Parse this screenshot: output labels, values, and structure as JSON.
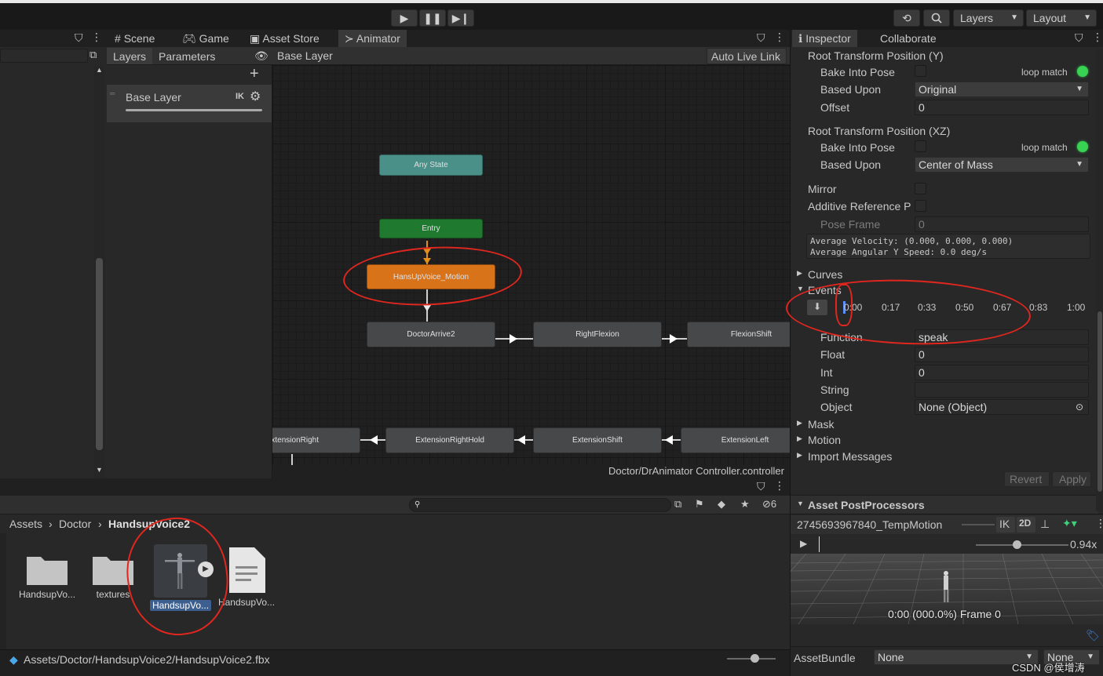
{
  "toolbar": {
    "layers_label": "Layers",
    "layout_label": "Layout"
  },
  "hierarchy": {},
  "center_tabs": [
    "Scene",
    "Game",
    "Asset Store",
    "Animator"
  ],
  "animator": {
    "left_tabs": [
      "Layers",
      "Parameters"
    ],
    "breadcrumb": "Base Layer",
    "auto_live_link": "Auto Live Link",
    "layer_name": "Base Layer",
    "ik_label": "IK",
    "footer_path": "Doctor/DrAnimator Controller.controller",
    "nodes": {
      "any_state": "Any State",
      "entry": "Entry",
      "motion": "HansUpVoice_Motion",
      "doctor_arrive": "DoctorArrive2",
      "right_flexion": "RightFlexion",
      "flexion_shift": "FlexionShift",
      "extension_right": "ExtensionRight",
      "extension_right_hold": "ExtensionRightHold",
      "extension_shift": "ExtensionShift",
      "extension_left": "ExtensionLeft"
    }
  },
  "inspector": {
    "tabs": [
      "Inspector",
      "Collaborate"
    ],
    "root_y_title": "Root Transform Position (Y)",
    "bake_into_pose": "Bake Into Pose",
    "loop_match": "loop match",
    "based_upon": "Based Upon",
    "based_upon_y": "Original",
    "offset_label": "Offset",
    "offset_value": "0",
    "root_xz_title": "Root Transform Position (XZ)",
    "based_upon_xz": "Center of Mass",
    "mirror": "Mirror",
    "additive_ref": "Additive Reference P",
    "pose_frame": "Pose Frame",
    "pose_frame_value": "0",
    "avg_velocity": "Average Velocity: (0.000, 0.000, 0.000)",
    "avg_angular": "Average Angular Y Speed: 0.0 deg/s",
    "curves": "Curves",
    "events": "Events",
    "timeline_ticks": [
      "0:00",
      "0:17",
      "0:33",
      "0:50",
      "0:67",
      "0:83",
      "1:00"
    ],
    "function_label": "Function",
    "function_value": "speak",
    "float_label": "Float",
    "float_value": "0",
    "int_label": "Int",
    "int_value": "0",
    "string_label": "String",
    "string_value": "",
    "object_label": "Object",
    "object_value": "None (Object)",
    "mask": "Mask",
    "motion": "Motion",
    "import_messages": "Import Messages",
    "revert": "Revert",
    "apply": "Apply",
    "asset_postprocessors": "Asset PostProcessors"
  },
  "preview": {
    "clip_name": "2745693967840_TempMotion",
    "ik": "IK",
    "mode_2d": "2D",
    "speed": "0.94x",
    "time_readout": "0:00 (000.0%) Frame 0",
    "asset_bundle_label": "AssetBundle",
    "asset_bundle_value": "None",
    "variant_value": "None",
    "watermark": "CSDN @侯增涛"
  },
  "project": {
    "breadcrumb": [
      "Assets",
      "Doctor",
      "HandsupVoice2"
    ],
    "hidden_count": "6",
    "assets": [
      {
        "name": "HandsupVo...",
        "kind": "folder"
      },
      {
        "name": "textures",
        "kind": "folder"
      },
      {
        "name": "HandsupVo...",
        "kind": "model",
        "selected": true
      },
      {
        "name": "HandsupVo...",
        "kind": "document"
      }
    ],
    "status_path": "Assets/Doctor/HandsupVoice2/HandsupVoice2.fbx"
  },
  "colors": {
    "motion_node": "#d9731a",
    "any_state_node": "#4a8f88",
    "entry_node": "#1f7a2f",
    "annotation": "#e0271f",
    "loop_match": "#39d353"
  }
}
